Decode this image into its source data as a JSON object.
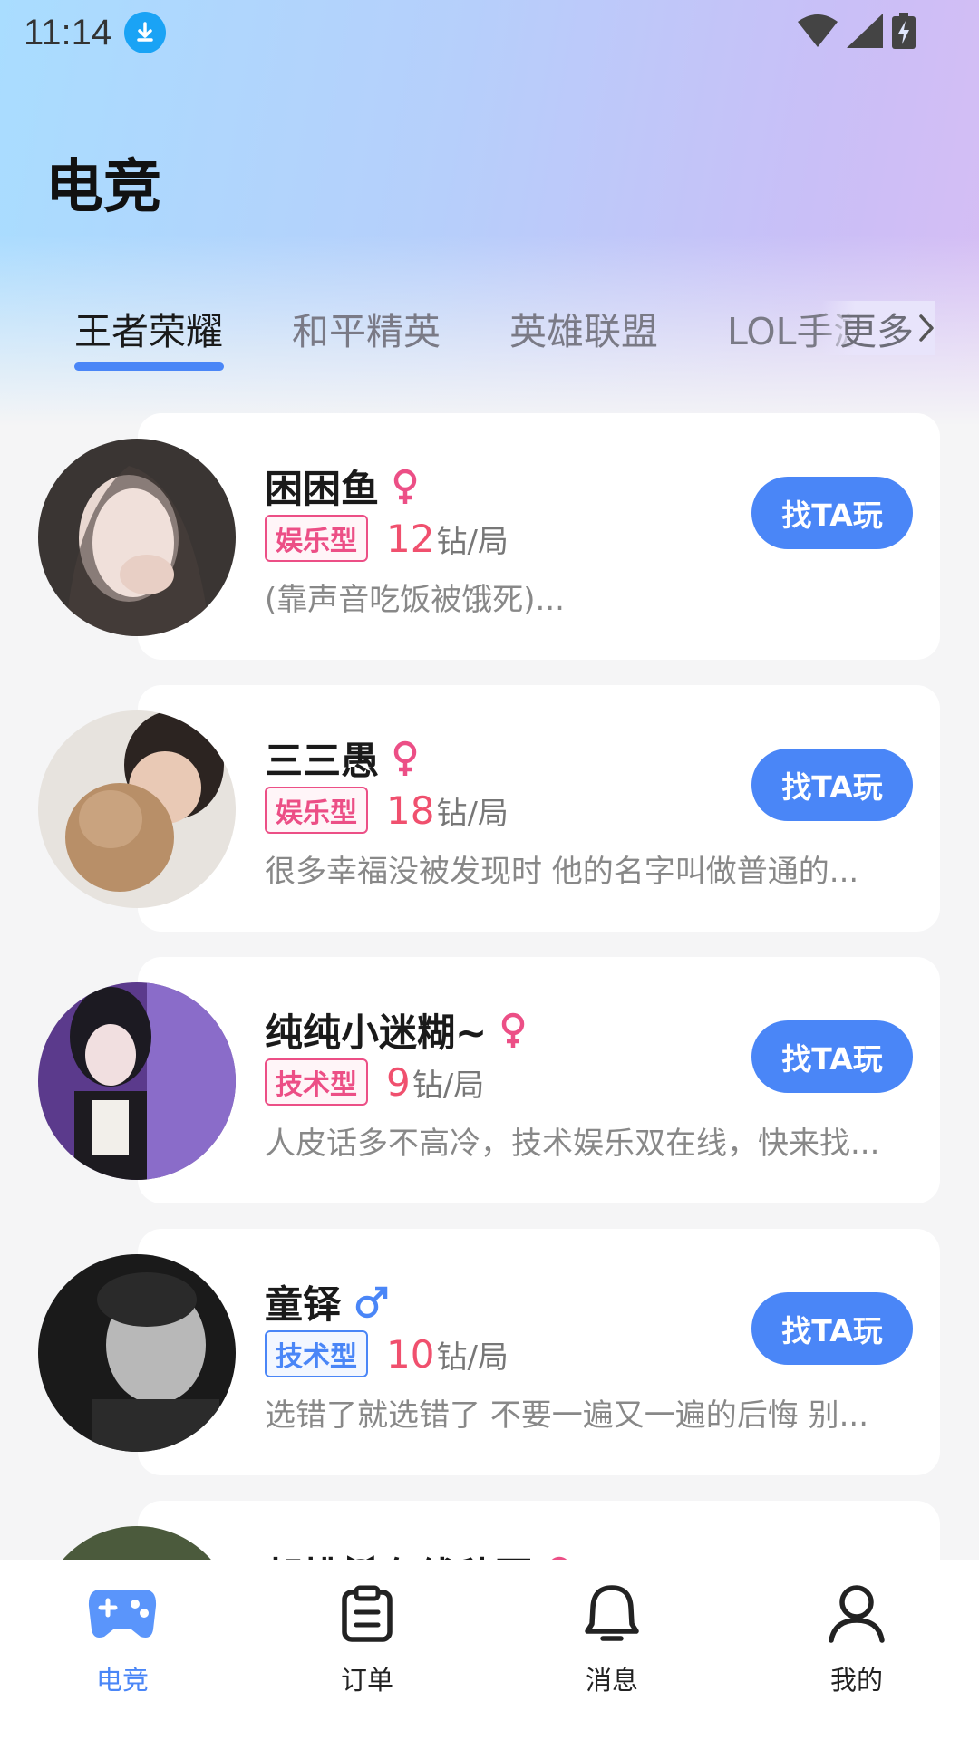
{
  "status_bar": {
    "time": "11:14"
  },
  "header": {
    "title": "电竞"
  },
  "tabs": [
    {
      "label": "王者荣耀",
      "active": true
    },
    {
      "label": "和平精英",
      "active": false
    },
    {
      "label": "英雄联盟",
      "active": false
    },
    {
      "label": "LOL手游",
      "active": false
    }
  ],
  "tabs_more": "更多",
  "players": [
    {
      "name": "困困鱼",
      "gender": "female",
      "tag": "娱乐型",
      "tag_color": "pink",
      "price": "12",
      "unit": "钻/局",
      "desc": "(靠声音吃饭被饿死)...",
      "button": "找TA玩"
    },
    {
      "name": "三三愚",
      "gender": "female",
      "tag": "娱乐型",
      "tag_color": "pink",
      "price": "18",
      "unit": "钻/局",
      "desc": "很多幸福没被发现时 他的名字叫做普通的...",
      "button": "找TA玩"
    },
    {
      "name": "纯纯小迷糊~",
      "gender": "female",
      "tag": "技术型",
      "tag_color": "pink",
      "price": "9",
      "unit": "钻/局",
      "desc": "人皮话多不高冷，技术娱乐双在线，快来找...",
      "button": "找TA玩"
    },
    {
      "name": "童铎",
      "gender": "male",
      "tag": "技术型",
      "tag_color": "blue",
      "price": "10",
      "unit": "钻/局",
      "desc": "选错了就选错了 不要一遍又一遍的后悔 别...",
      "button": "找TA玩"
    },
    {
      "name": "胡桃😈在线秒回",
      "gender": "female",
      "tag": "",
      "tag_color": "pink",
      "price": "",
      "unit": "",
      "desc": "",
      "button": ""
    }
  ],
  "bottom_nav": [
    {
      "label": "电竞",
      "icon": "gamepad-icon",
      "active": true
    },
    {
      "label": "订单",
      "icon": "clipboard-icon",
      "active": false
    },
    {
      "label": "消息",
      "icon": "bell-icon",
      "active": false
    },
    {
      "label": "我的",
      "icon": "user-icon",
      "active": false
    }
  ],
  "colors": {
    "accent": "#4a86f7",
    "price": "#f0506e",
    "female": "#ec4f86",
    "male": "#4a86f7"
  }
}
